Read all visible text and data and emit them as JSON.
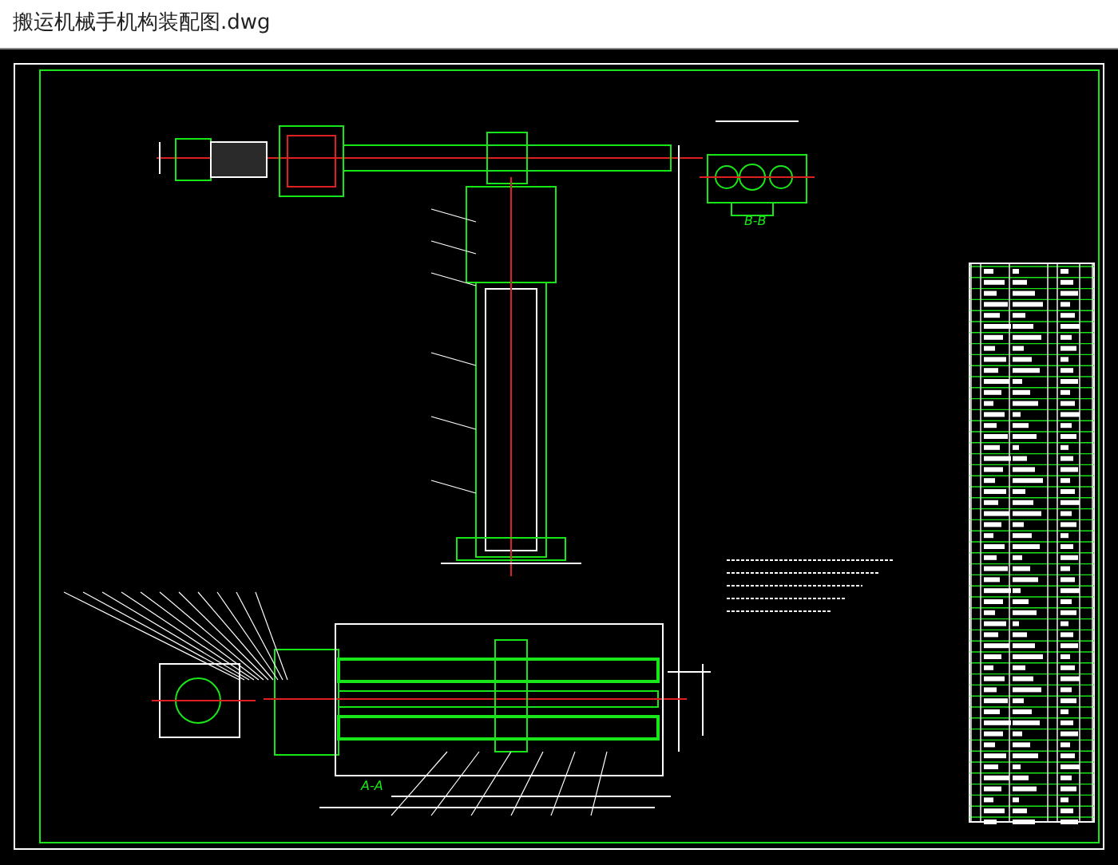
{
  "window": {
    "title": "搬运机械手机构装配图.dwg"
  },
  "drawing": {
    "section_labels": [
      "B-B",
      "A-A"
    ]
  }
}
